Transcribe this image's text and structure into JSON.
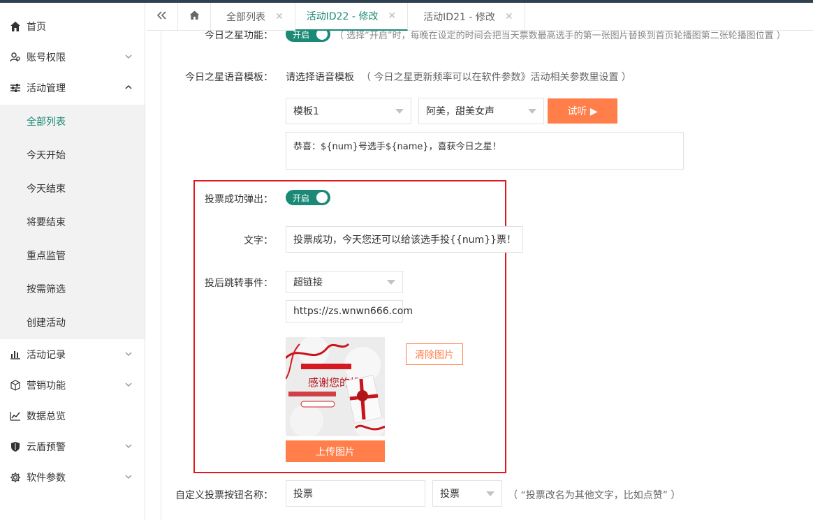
{
  "sidebar": {
    "items": [
      {
        "label": "首页",
        "icon": "home-icon",
        "chevron": false
      },
      {
        "label": "账号权限",
        "icon": "users-icon",
        "chevron": "down"
      },
      {
        "label": "活动管理",
        "icon": "sliders-icon",
        "chevron": "up"
      }
    ],
    "submenu": [
      {
        "label": "全部列表",
        "active": true
      },
      {
        "label": "今天开始",
        "active": false
      },
      {
        "label": "今天结束",
        "active": false
      },
      {
        "label": "将要结束",
        "active": false
      },
      {
        "label": "重点监管",
        "active": false
      },
      {
        "label": "按需筛选",
        "active": false
      },
      {
        "label": "创建活动",
        "active": false
      }
    ],
    "items2": [
      {
        "label": "活动记录",
        "icon": "bar-chart-icon",
        "chevron": "down"
      },
      {
        "label": "营销功能",
        "icon": "cube-icon",
        "chevron": "down"
      },
      {
        "label": "数据总览",
        "icon": "line-chart-icon",
        "chevron": false
      },
      {
        "label": "云盾预警",
        "icon": "shield-icon",
        "chevron": "down"
      },
      {
        "label": "软件参数",
        "icon": "gear-icon",
        "chevron": "down"
      }
    ]
  },
  "tabs": {
    "collapse_icon": "double-chevron-left-icon",
    "home_icon": "home-icon",
    "items": [
      {
        "label": "全部列表",
        "active": false
      },
      {
        "label": "活动ID22 - 修改",
        "active": true
      },
      {
        "label": "活动ID21 - 修改",
        "active": false
      }
    ]
  },
  "form": {
    "top_partial_label": "今日之星功能：",
    "top_partial_toggle": "开启",
    "top_partial_hint": "（ 选择“开启”时，每晚在设定的时间会把当天票数最高选手的第一张图片替换到首页轮播图第二张轮播图位置 ）",
    "voice_label": "今日之星语音模板：",
    "voice_text": "请选择语音模板",
    "voice_hint": "（ 今日之星更新频率可以在软件参数》活动相关参数里设置 ）",
    "template_select": "模板1",
    "voice_select": "阿美，甜美女声",
    "listen_button": "试听 ▶",
    "message_text": "恭喜：${num}号选手${name}，喜获今日之星！",
    "popup_label": "投票成功弹出：",
    "popup_toggle": "开启",
    "text_label": "文字：",
    "text_value": "投票成功，今天您还可以给该选手投{{num}}票！",
    "jump_label": "投后跳转事件：",
    "jump_select": "超链接",
    "jump_url": "https://zs.wnwn666.com",
    "clear_image_button": "清除图片",
    "upload_button": "上传图片",
    "preview_title": "感谢您的投票",
    "custom_label": "自定义投票按钮名称：",
    "custom_value": "投票",
    "custom_select": "投票",
    "custom_hint": "（ “投票改名为其他文字，比如点赞” ）"
  },
  "colors": {
    "accent": "#1a8a76",
    "orange": "#ff7e4a",
    "red_box": "#e0191c"
  }
}
